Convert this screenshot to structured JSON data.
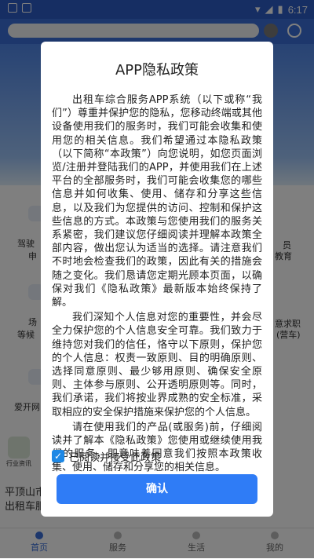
{
  "status_bar": {
    "time": "6:17"
  },
  "background": {
    "side_labels": [
      "驾驶",
      "申",
      "场",
      "等候",
      "爱开网",
      "员",
      "教育",
      "意求职",
      "(营车)"
    ],
    "bottom_text_1": "平顶山市",
    "bottom_text_2": "出租车服",
    "card_label": "行业资讯"
  },
  "nav": {
    "items": [
      {
        "label": "首页"
      },
      {
        "label": "服务"
      },
      {
        "label": "生活"
      },
      {
        "label": "我的"
      }
    ]
  },
  "dialog": {
    "title": "APP隐私政策",
    "paragraphs": [
      "出租车综合服务APP系统（以下或称“我们”）尊重并保护您的隐私，您移动终端或其他设备使用我们的服务时，我们可能会收集和使用您的相关信息。我们希望通过本隐私政策（以下简称“本政策”）向您说明，如您页面浏览/注册并登陆我们的APP，并使用我们在上述平台的全部服务时，我们可能会收集您的哪些信息并如何收集、使用、储存和分享这些信息，以及我们为您提供的访问、控制和保护这些信息的方式。本政策与您使用我们的服务关系紧密，我们建议您仔细阅读并理解本政策全部内容，做出您认为适当的选择。请注意我们不时地会检查我们的政策，因此有关的措施会随之变化。我们恳请您定期光顾本页面，以确保对我们《隐私政策》最新版本始终保持了解。",
      "我们深知个人信息对您的重要性，并会尽全力保护您的个人信息安全可靠。我们致力于维持您对我们的信任，恪守以下原则，保护您的个人信息：权责一致原则、目的明确原则、选择同意原则、最少够用原则、确保安全原则、主体参与原则、公开透明原则等。同时，我们承诺，我们将按业界成熟的安全标准，采取相应的安全保护措施来保护您的个人信息。",
      "请在使用我们的产品(或服务)前，仔细阅读并了解本《隐私政策》您使用或继续使用我们的服务，即意味着同意我们按照本政策收集、使用、储存和分享您的相关信息。"
    ],
    "consent_label": "已阅读并接受此政策",
    "consent_checked": true,
    "confirm_label": "确认"
  }
}
